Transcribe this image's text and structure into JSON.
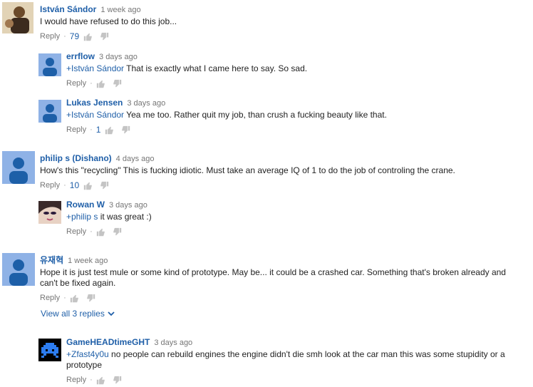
{
  "comments": [
    {
      "author": "István Sándor",
      "time": "1 week ago",
      "text": "I would have refused to do this job...",
      "reply": "Reply",
      "likes": "79"
    },
    {
      "author": "errflow",
      "time": "3 days ago",
      "mention": "+István Sándor",
      "text": " That is exactly what I came here to say. So sad.",
      "reply": "Reply",
      "likes": ""
    },
    {
      "author": "Lukas Jensen",
      "time": "3 days ago",
      "mention": "+István Sándor",
      "text": " Yea me too. Rather quit my job, than crush a fucking beauty like that.",
      "reply": "Reply",
      "likes": "1"
    },
    {
      "author": "philip s (Dishano)",
      "time": "4 days ago",
      "text": "How's this \"recycling\" This is fucking idiotic. Must take an average IQ of 1 to do the job of controling the crane.",
      "reply": "Reply",
      "likes": "10"
    },
    {
      "author": "Rowan W",
      "time": "3 days ago",
      "mention": "+philip s",
      "text": " it was great :)",
      "reply": "Reply",
      "likes": ""
    },
    {
      "author": "유재혁",
      "time": "1 week ago",
      "text": "Hope it is just test mule or some kind of prototype. May be... it could be a crashed car. Something that's broken already and can't be fixed again.",
      "reply": "Reply",
      "likes": ""
    },
    {
      "author": "GameHEADtimeGHT",
      "time": "3 days ago",
      "mention": "+Zfast4y0u",
      "text": " no people can rebuild engines the engine didn't die smh look at the car man this was some stupidity or a prototype",
      "reply": "Reply",
      "likes": ""
    }
  ],
  "view_replies": "View all 3 replies",
  "colors": {
    "link": "#1f5fa8",
    "meta": "#767676",
    "avatar_default": "#8fb2e6"
  }
}
